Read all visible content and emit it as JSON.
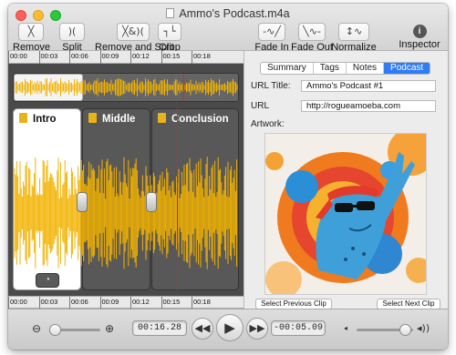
{
  "window": {
    "title": "Ammo's Podcast.m4a"
  },
  "toolbar": {
    "remove": {
      "label": "Remove",
      "glyph": "╳"
    },
    "split": {
      "label": "Split",
      "glyph": ")("
    },
    "remove_split": {
      "label": "Remove and Split",
      "glyph": "╳&)("
    },
    "crop": {
      "label": "Crop",
      "glyph": "┐└"
    },
    "fade_in": {
      "label": "Fade In",
      "glyph": "-∿╱"
    },
    "fade_out": {
      "label": "Fade Out",
      "glyph": "╲∿-"
    },
    "normalize": {
      "label": "Normalize",
      "glyph": "↕∿"
    },
    "inspector": {
      "label": "Inspector",
      "glyph": "i"
    }
  },
  "ruler": {
    "ticks": [
      "00:00",
      "00:03",
      "00:06",
      "00:09",
      "00:12",
      "00:15",
      "00:18"
    ]
  },
  "segments": [
    {
      "name": "Intro"
    },
    {
      "name": "Middle"
    },
    {
      "name": "Conclusion"
    }
  ],
  "inspector": {
    "tabs": [
      "Summary",
      "Tags",
      "Notes",
      "Podcast"
    ],
    "active_tab": "Podcast",
    "url_title_label": "URL Title:",
    "url_title_value": "Ammo's Podcast #1",
    "url_label": "URL",
    "url_value": "http://rogueamoeba.com",
    "artwork_label": "Artwork:",
    "prev_clip": "Select Previous Clip",
    "next_clip": "Select Next Clip"
  },
  "transport": {
    "current_time": "00:16.28",
    "remaining_time": "-00:05.09",
    "zoom_level": 0.1,
    "volume_level": 0.85
  },
  "colors": {
    "waveform": "#f2b200",
    "accent": "#2f7cf6",
    "playhead": "#e52020"
  }
}
